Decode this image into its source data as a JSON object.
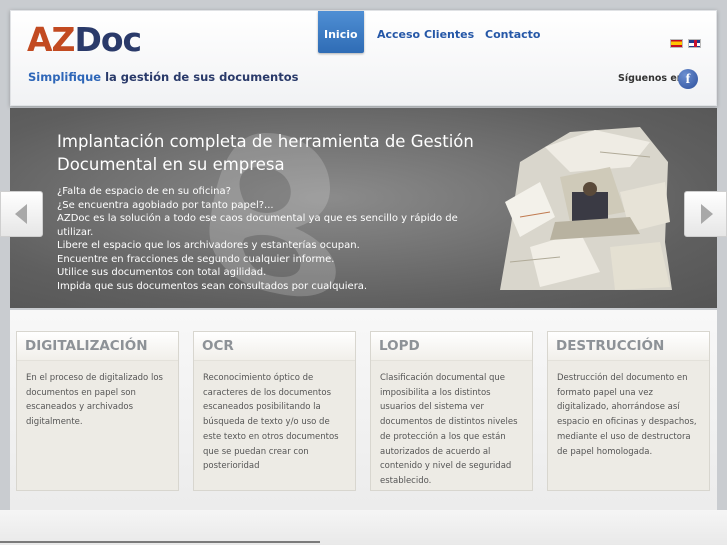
{
  "header": {
    "logo": {
      "az": "AZ",
      "doc": "Doc"
    },
    "tagline": {
      "highlight": "Simplifique",
      "rest": " la gestión de sus documentos"
    },
    "nav": [
      {
        "label": "Inicio",
        "active": true
      },
      {
        "label": "Acceso Clientes",
        "active": false
      },
      {
        "label": "Contacto",
        "active": false
      }
    ],
    "follow_label": "Síguenos en:",
    "facebook_glyph": "f"
  },
  "banner": {
    "title": "Implantación completa de herramienta de Gestión Documental en su empresa",
    "lines": [
      "¿Falta de espacio de en su oficina?",
      "¿Se encuentra agobiado por tanto papel?...",
      "AZDoc es la solución a todo ese caos documental ya que es sencillo y rápido de utilizar.",
      "Libere el espacio que los archivadores y estanterías ocupan.",
      "Encuentre en fracciones de segundo cualquier informe.",
      "Utilice sus documentos con total agilidad.",
      "Impida que sus documentos sean consultados por cualquiera."
    ]
  },
  "services": [
    {
      "title": "DIGITALIZACIÓN",
      "text": "En el proceso de digitalizado los documentos en papel son escaneados y archivados digitalmente."
    },
    {
      "title": "OCR",
      "text": "Reconocimiento óptico de caracteres de los documentos escaneados posibilitando la búsqueda de texto y/o uso de este texto en otros documentos que se puedan crear con posterioridad"
    },
    {
      "title": "LOPD",
      "text": "Clasificación documental que imposibilita a los distintos usuarios del sistema ver documentos de distintos niveles de protección a los que están autorizados de acuerdo al contenido y nivel de seguridad establecido."
    },
    {
      "title": "DESTRUCCIÓN",
      "text": "Destrucción del documento en formato papel una vez digitalizado, ahorrándose así espacio en oficinas y despachos, mediante el uso de destructora de papel homologada."
    }
  ],
  "icons": {
    "flag_es": "spanish-flag-icon",
    "flag_en": "english-flag-icon",
    "prev": "chevron-left-icon",
    "next": "chevron-right-icon",
    "facebook": "facebook-icon"
  },
  "colors": {
    "brand_orange": "#c24a21",
    "brand_navy": "#2a3a6a",
    "link_blue": "#2557a7",
    "active_tab": "#3a7cc5"
  }
}
